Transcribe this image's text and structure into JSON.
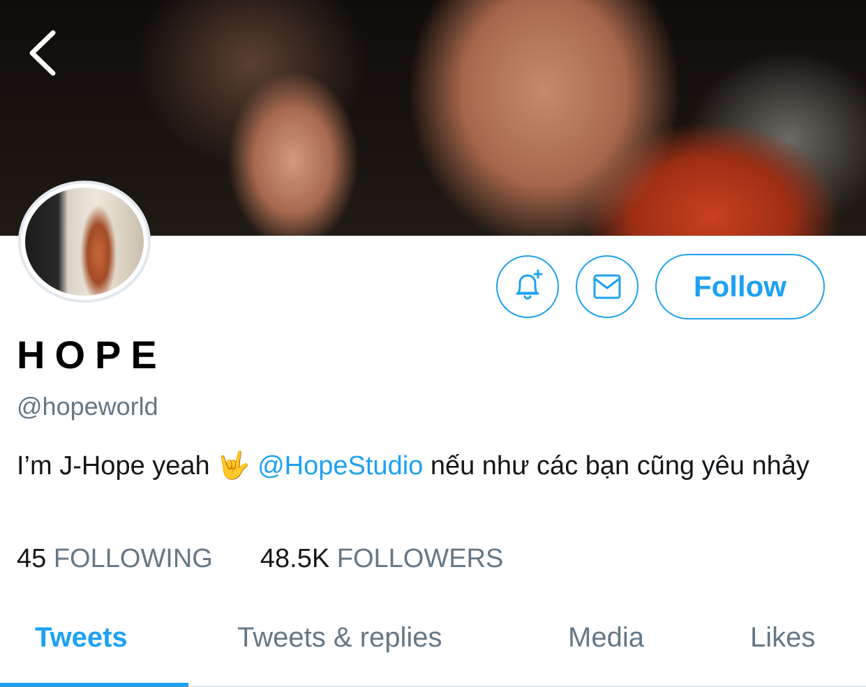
{
  "profile": {
    "display_name": "HOPE",
    "handle": "@hopeworld",
    "bio_text": "I’m J-Hope yeah 🤟 ",
    "bio_mention": "@HopeStudio",
    "bio_rest": " nếu như các bạn cũng yêu nhảy",
    "follow_label": "Follow"
  },
  "stats": {
    "following_count": "45",
    "following_label": "FOLLOWING",
    "followers_count": "48.5K",
    "followers_label": "FOLLOWERS"
  },
  "tabs": [
    {
      "label": "Tweets",
      "active": true
    },
    {
      "label": "Tweets & replies",
      "active": false
    },
    {
      "label": "Media",
      "active": false
    },
    {
      "label": "Likes",
      "active": false
    }
  ],
  "icons": {
    "back": "chevron-left-icon",
    "notify": "bell-plus-icon",
    "message": "mail-icon"
  },
  "colors": {
    "accent": "#1da1f2",
    "secondary_text": "#657786"
  }
}
